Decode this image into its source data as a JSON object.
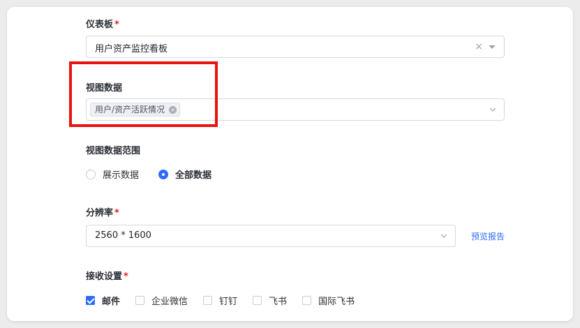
{
  "dashboard": {
    "label": "仪表板",
    "required_mark": "*",
    "value": "用户资产监控看板",
    "clear_glyph": "×"
  },
  "view_data": {
    "label": "视图数据",
    "tag": "用户/资产活跃情况",
    "tag_close_glyph": "×"
  },
  "view_range": {
    "label": "视图数据范围",
    "options": [
      {
        "label": "展示数据",
        "selected": false
      },
      {
        "label": "全部数据",
        "selected": true
      }
    ]
  },
  "resolution": {
    "label": "分辨率",
    "required_mark": "*",
    "value": "2560 * 1600",
    "preview_link": "预览报告"
  },
  "receive": {
    "label": "接收设置",
    "required_mark": "*",
    "options": [
      {
        "label": "邮件",
        "checked": true
      },
      {
        "label": "企业微信",
        "checked": false
      },
      {
        "label": "钉钉",
        "checked": false
      },
      {
        "label": "飞书",
        "checked": false
      },
      {
        "label": "国际飞书",
        "checked": false
      }
    ]
  },
  "colors": {
    "accent": "#2f6bff",
    "required": "#e02020",
    "highlight_box": "#e8130f"
  },
  "icons": {
    "dropdown": "chevron-down-icon",
    "solid_dropdown": "caret-down-icon",
    "clear": "close-icon",
    "checkbox_checked": "check-icon"
  }
}
